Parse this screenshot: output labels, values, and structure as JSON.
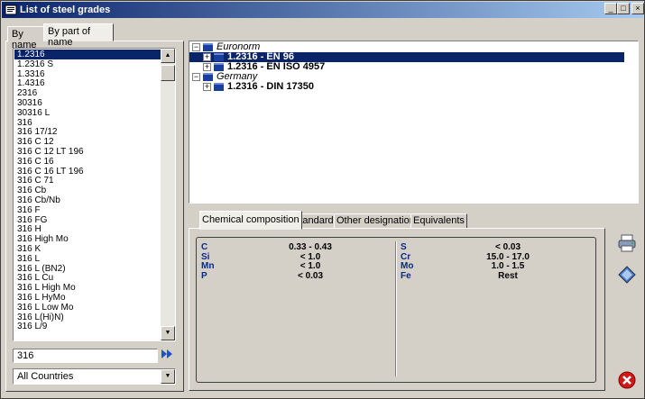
{
  "window": {
    "title": "List of steel grades",
    "buttons": [
      "_",
      "□",
      "×"
    ]
  },
  "left_tabs": [
    "By name",
    "By part of name"
  ],
  "grades": [
    "1.2316",
    "1.2316 S",
    "1.3316",
    "1.4316",
    "2316",
    "30316",
    "30316 L",
    "316",
    "316 17/12",
    "316 C 12",
    "316 C 12 LT 196",
    "316 C 16",
    "316 C 16 LT 196",
    "316 C 71",
    "316 Cb",
    "316 Cb/Nb",
    "316 F",
    "316 FG",
    "316 H",
    "316 High Mo",
    "316 K",
    "316 L",
    "316 L (BN2)",
    "316 L Cu",
    "316 L High Mo",
    "316 L HyMo",
    "316 L Low Mo",
    "316 L(Hi)N)",
    "316 L/9"
  ],
  "selected_grade_index": 0,
  "search": {
    "value": "316"
  },
  "country_filter": {
    "value": "All Countries"
  },
  "tree": {
    "groups": [
      {
        "name": "Euronorm",
        "items": [
          {
            "grade": "1.2316",
            "standard": "EN 96",
            "highlighted": true
          },
          {
            "grade": "1.2316",
            "standard": "EN ISO 4957",
            "highlighted": false
          }
        ]
      },
      {
        "name": "Germany",
        "items": [
          {
            "grade": "1.2316",
            "standard": "DIN 17350",
            "highlighted": false
          }
        ]
      }
    ]
  },
  "right_tabs": [
    "Chemical composition",
    "Standards",
    "Other designations",
    "Equivalents"
  ],
  "active_right_tab": 0,
  "chemical_composition": {
    "left": [
      {
        "element": "C",
        "value": "0.33 - 0.43"
      },
      {
        "element": "Si",
        "value": "< 1.0"
      },
      {
        "element": "Mn",
        "value": "< 1.0"
      },
      {
        "element": "P",
        "value": "< 0.03"
      }
    ],
    "right": [
      {
        "element": "S",
        "value": "< 0.03"
      },
      {
        "element": "Cr",
        "value": "15.0 - 17.0"
      },
      {
        "element": "Mo",
        "value": "1.0 - 1.5"
      },
      {
        "element": "Fe",
        "value": "Rest"
      }
    ]
  },
  "icons": {
    "print": "printer-icon",
    "export": "export-icon",
    "close": "close-circle-icon"
  },
  "colors": {
    "title_bar": "#0a246a",
    "selection": "#0a246a",
    "element_label": "#0a2a80",
    "close_red": "#d01818"
  }
}
